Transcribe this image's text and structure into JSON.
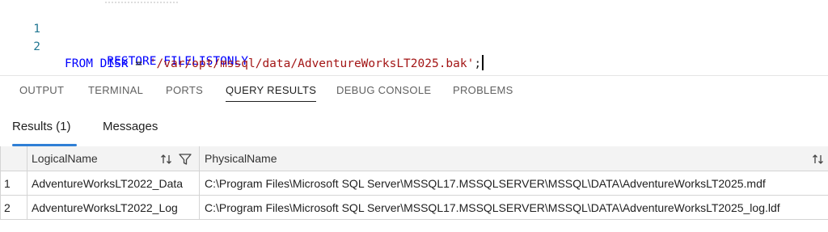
{
  "editor": {
    "lines": [
      {
        "number": "1",
        "keyword": "RESTORE FILELISTONLY"
      },
      {
        "number": "2",
        "keyword": "FROM DISK",
        "operator": " = ",
        "string": "'/var/opt/mssql/data/AdventureWorksLT2025.bak'",
        "terminator": ";"
      }
    ]
  },
  "panel_tabs": [
    {
      "label": "OUTPUT"
    },
    {
      "label": "TERMINAL"
    },
    {
      "label": "PORTS"
    },
    {
      "label": "QUERY RESULTS",
      "active": true
    },
    {
      "label": "DEBUG CONSOLE"
    },
    {
      "label": "PROBLEMS"
    }
  ],
  "result_tabs": [
    {
      "label": "Results (1)",
      "active": true
    },
    {
      "label": "Messages"
    }
  ],
  "grid": {
    "columns": [
      "LogicalName",
      "PhysicalName"
    ],
    "rows": [
      {
        "index": "1",
        "LogicalName": "AdventureWorksLT2022_Data",
        "PhysicalName": "C:\\Program Files\\Microsoft SQL Server\\MSSQL17.MSSQLSERVER\\MSSQL\\DATA\\AdventureWorksLT2025.mdf"
      },
      {
        "index": "2",
        "LogicalName": "AdventureWorksLT2022_Log",
        "PhysicalName": "C:\\Program Files\\Microsoft SQL Server\\MSSQL17.MSSQLSERVER\\MSSQL\\DATA\\AdventureWorksLT2025_log.ldf"
      }
    ]
  },
  "colors": {
    "keyword": "#0000ff",
    "string": "#a31515",
    "accent": "#2f7fd6",
    "line_number": "#237893"
  },
  "icons": [
    "sort-icon",
    "filter-icon"
  ]
}
